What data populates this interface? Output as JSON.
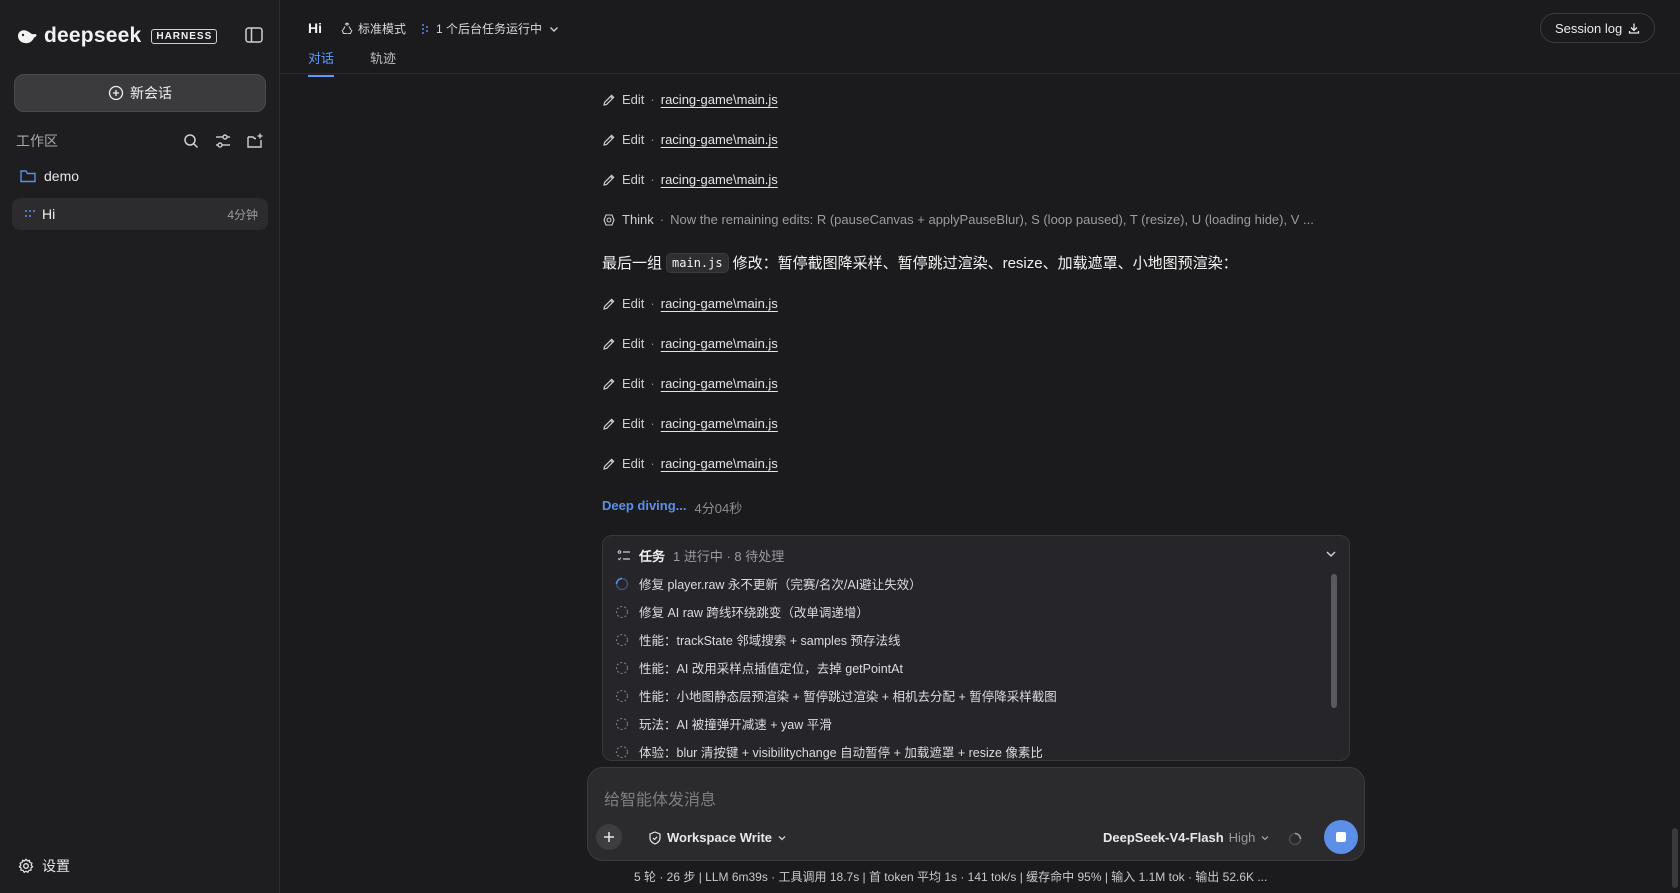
{
  "sidebar": {
    "brand": "deepseek",
    "brand_tag": "HARNESS",
    "new_chat_label": "新会话",
    "workspace_label": "工作区",
    "folder_name": "demo",
    "session": {
      "title": "Hi",
      "time": "4分钟"
    },
    "settings_label": "设置"
  },
  "header": {
    "title": "Hi",
    "mode": "标准模式",
    "background_tasks": "1 个后台任务运行中",
    "tabs": [
      {
        "label": "对话"
      },
      {
        "label": "轨迹"
      }
    ],
    "session_log_label": "Session log"
  },
  "transcript": {
    "edit_label": "Edit",
    "sep": "·",
    "file": "racing-game\\main.js",
    "think_label": "Think",
    "think_text": "Now the remaining edits: R (pauseCanvas + applyPauseBlur), S (loop paused), T (resize), U (loading hide), V ...",
    "heading_prefix": "最后一组",
    "heading_code": "main.js",
    "heading_suffix": "修改：暂停截图降采样、暂停跳过渲染、resize、加载遮罩、小地图预渲染：",
    "deep_label": "Deep diving...",
    "deep_time": "4分04秒"
  },
  "tasks": {
    "title": "任务",
    "summary": "1 进行中 · 8 待处理",
    "items": [
      {
        "label": "修复 player.raw 永不更新（完赛/名次/AI避让失效）",
        "status": "in-progress"
      },
      {
        "label": "修复 AI raw 跨线环绕跳变（改单调递增）",
        "status": "pending"
      },
      {
        "label": "性能：trackState 邻域搜索 + samples 预存法线",
        "status": "pending"
      },
      {
        "label": "性能：AI 改用采样点插值定位，去掉 getPointAt",
        "status": "pending"
      },
      {
        "label": "性能：小地图静态层预渲染 + 暂停跳过渲染 + 相机去分配 + 暂停降采样截图",
        "status": "pending"
      },
      {
        "label": "玩法：AI 被撞弹开减速 + yaw 平滑",
        "status": "pending"
      },
      {
        "label": "体验：blur 清按键 + visibilitychange 自动暂停 + 加载遮罩 + resize 像素比",
        "status": "pending"
      }
    ]
  },
  "composer": {
    "placeholder": "给智能体发消息",
    "workspace_mode": "Workspace Write",
    "model": "DeepSeek-V4-Flash",
    "level": "High"
  },
  "stats": "5 轮 · 26 步   |   LLM 6m39s · 工具调用 18.7s   |   首 token 平均 1s · 141 tok/s   |   缓存命中 95%   |   输入 1.1M tok · 输出 52.6K ...",
  "colors": {
    "accent": "#5b8fe8",
    "tab_active": "#5b9bff",
    "background": "#1b1b1d"
  }
}
